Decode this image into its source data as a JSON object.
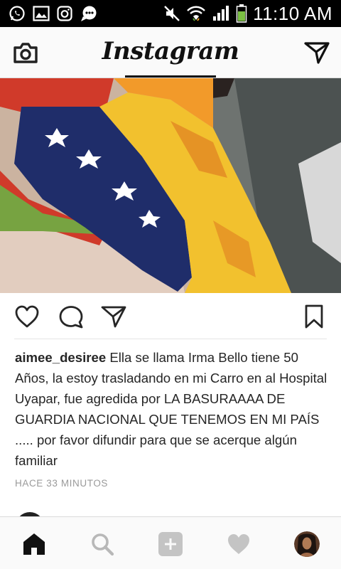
{
  "status_bar": {
    "time": "11:10 AM",
    "icons": [
      "whatsapp-icon",
      "gallery-icon",
      "instagram-notification-icon",
      "chat-bubble-icon",
      "mute-icon",
      "wifi-icon",
      "signal-icon",
      "battery-icon"
    ]
  },
  "header": {
    "logo_text": "Instagram",
    "icons": [
      "camera-icon",
      "direct-message-icon"
    ]
  },
  "post": {
    "photo_description_icon": "post-photo",
    "actions": [
      "like-icon",
      "comment-icon",
      "share-icon",
      "bookmark-icon"
    ],
    "username": "aimee_desiree",
    "caption_text": "Ella se llama Irma Bello tiene 50 Años, la estoy trasladando en mi Carro en al Hospital Uyapar, fue agredida por LA BASURAAAA DE GUARDIA NACIONAL QUE TENEMOS EN MI PAÍS ..... por favor difundir para que se acerque algún familiar",
    "timestamp": "HACE 33 MINUTOS"
  },
  "bottom_nav": {
    "items": [
      "home-icon",
      "search-icon",
      "add-icon",
      "activity-heart-icon",
      "profile-avatar"
    ]
  },
  "colors": {
    "status_bar": "#000000",
    "header_bg": "#fafafa",
    "text": "#262626",
    "muted": "#9a9a9a",
    "battery": "#7bc043"
  }
}
